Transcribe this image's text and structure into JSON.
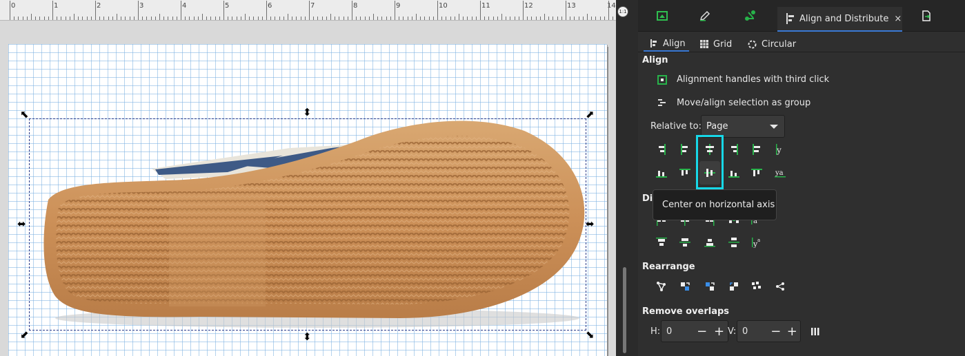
{
  "ruler": {
    "labels": [
      "0",
      "1",
      "2",
      "3",
      "4",
      "5",
      "6",
      "7",
      "8",
      "9",
      "10",
      "11",
      "12",
      "13",
      "14"
    ]
  },
  "zoom_button": {
    "label": "1:1"
  },
  "dock_tabs": [
    {
      "icon": "export-icon"
    },
    {
      "icon": "pen-edit-icon"
    },
    {
      "icon": "scissors-green-icon"
    },
    {
      "icon": "align-distribute-icon",
      "label": "Align and Distribute",
      "close": "×"
    },
    {
      "icon": "document-export-icon"
    }
  ],
  "sub_tabs": [
    {
      "label": "Align",
      "icon": "align-left-icon"
    },
    {
      "label": "Grid",
      "icon": "grid-icon"
    },
    {
      "label": "Circular",
      "icon": "circular-icon"
    }
  ],
  "align": {
    "heading": "Align",
    "option_handles": "Alignment handles with third click",
    "option_group": "Move/align selection as group",
    "relative_label": "Relative to:",
    "relative_value": "Page"
  },
  "tooltip": "Center on horizontal axis",
  "distribute": {
    "heading": "Distribute"
  },
  "rearrange": {
    "heading": "Rearrange"
  },
  "overlaps": {
    "heading": "Remove overlaps",
    "h_label": "H:",
    "h_value": "0",
    "v_label": "V:",
    "v_value": "0",
    "minus": "−",
    "plus": "+"
  },
  "colors": {
    "accent": "#3a7ad6",
    "highlight": "#17d8e8",
    "icon_green": "#27b34a",
    "panel_bg": "#2f2f2f"
  }
}
